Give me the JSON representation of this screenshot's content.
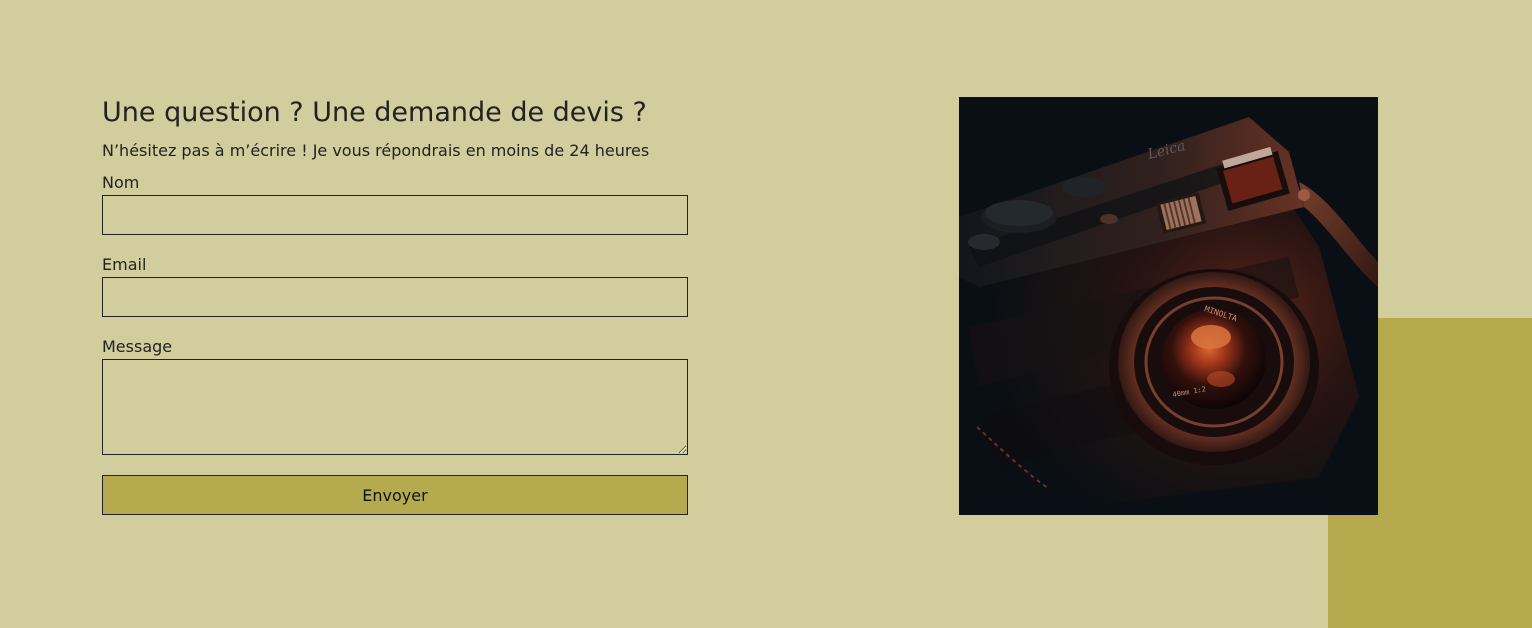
{
  "contact": {
    "title": "Une question ? Une demande de devis ?",
    "subtitle": "N’hésitez pas à m’écrire ! Je vous répondrais en moins de 24 heures",
    "fields": {
      "name": {
        "label": "Nom",
        "value": ""
      },
      "email": {
        "label": "Email",
        "value": ""
      },
      "message": {
        "label": "Message",
        "value": ""
      }
    },
    "submit_label": "Envoyer"
  },
  "photo": {
    "subject": "camera-photo",
    "lens_text": "MINOLTA M-ROKKOR 40mm 1:2",
    "brand_text": "Leica"
  },
  "colors": {
    "background": "#d2cd9d",
    "accent": "#b6aa4f",
    "text": "#222222"
  }
}
